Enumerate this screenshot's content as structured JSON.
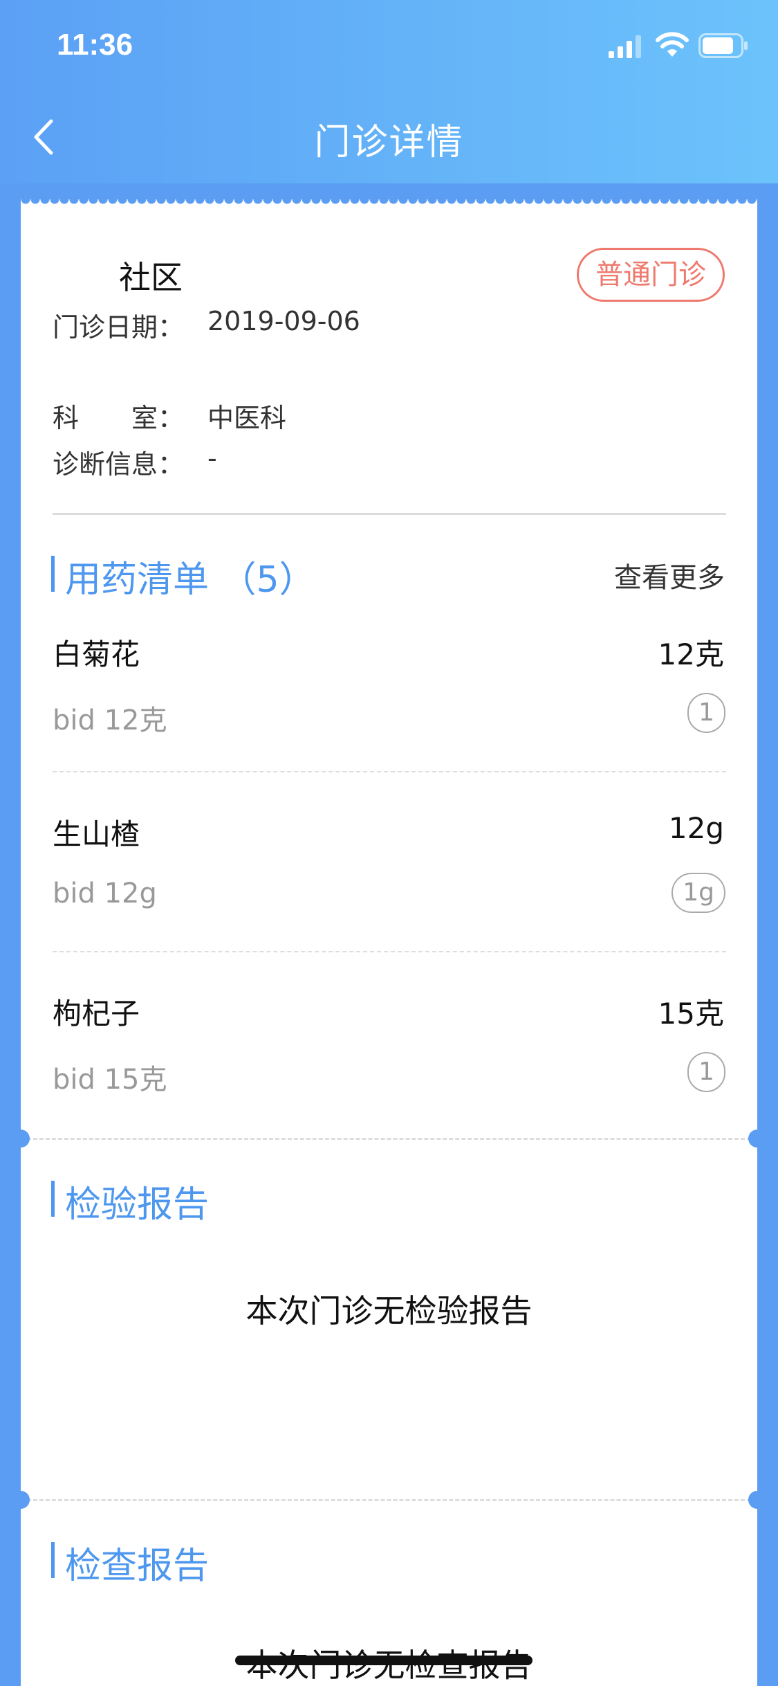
{
  "status_bar": {
    "time": "11:36"
  },
  "nav": {
    "title": "门诊详情"
  },
  "visit": {
    "hospital_name": "社区",
    "visit_type": "普通门诊",
    "date_label": "门诊日期：",
    "date_value": "2019-09-06",
    "department_label": "科　　室：",
    "department_value": "中医科",
    "diagnosis_label": "诊断信息：",
    "diagnosis_value": "-"
  },
  "medications": {
    "title": "用药清单 （5）",
    "more_label": "查看更多",
    "items": [
      {
        "name": "白菊花",
        "quantity": "12克",
        "usage": "bid 12克",
        "badge": "1"
      },
      {
        "name": "生山楂",
        "quantity": "12g",
        "usage": "bid 12g",
        "badge": "1g"
      },
      {
        "name": "枸杞子",
        "quantity": "15克",
        "usage": "bid 15克",
        "badge": "1"
      }
    ]
  },
  "lab_reports": {
    "title": "检验报告",
    "empty_text": "本次门诊无检验报告"
  },
  "exam_reports": {
    "title": "检查报告",
    "empty_text": "本次门诊无检查报告"
  },
  "colors": {
    "accent": "#4d97ef",
    "badge": "#ee7a6e",
    "header_start": "#5ba0f5",
    "header_end": "#6cc3fb"
  }
}
